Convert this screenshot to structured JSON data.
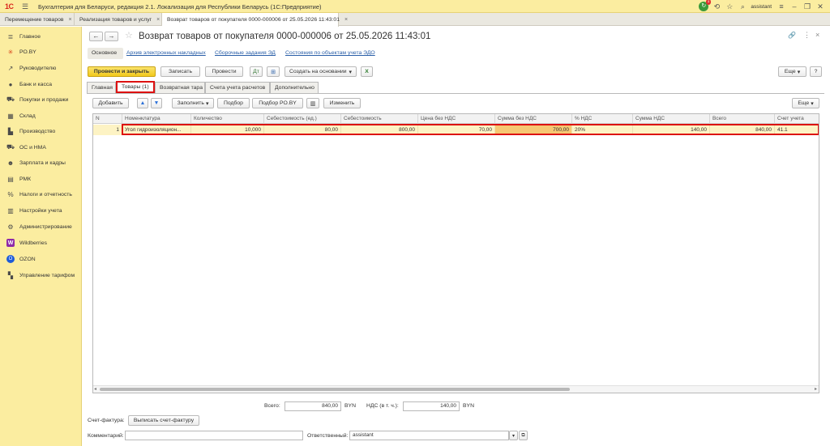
{
  "titlebar": {
    "logo": "1С",
    "menu_icon": "hamburger-icon",
    "title": "Бухгалтерия для Беларуси, редакция 2.1. Локализация для Республики Беларусь   (1С:Предприятие)",
    "notification_count": "1",
    "user": "assistant"
  },
  "doc_tabs": [
    {
      "label": "Перемещение товаров",
      "close": "×"
    },
    {
      "label": "Реализация товаров и услуг",
      "close": "×"
    },
    {
      "label": "Возврат товаров от покупателя 0000-000006 от 25.05.2026 11:43:01",
      "close": "×"
    }
  ],
  "sidebar": {
    "items": [
      {
        "label": "Главное",
        "icon": "menu-lines-icon"
      },
      {
        "label": "PO.BY",
        "icon": "asterisk-icon"
      },
      {
        "label": "Руководителю",
        "icon": "trend-icon"
      },
      {
        "label": "Банк и касса",
        "icon": "coin-icon"
      },
      {
        "label": "Покупки и продажи",
        "icon": "cart-icon"
      },
      {
        "label": "Склад",
        "icon": "warehouse-icon"
      },
      {
        "label": "Производство",
        "icon": "factory-icon"
      },
      {
        "label": "ОС и НМА",
        "icon": "truck-icon"
      },
      {
        "label": "Зарплата и кадры",
        "icon": "people-icon"
      },
      {
        "label": "РМК",
        "icon": "cash-register-icon"
      },
      {
        "label": "Налоги и отчетность",
        "icon": "percent-icon"
      },
      {
        "label": "Настройки учета",
        "icon": "ledger-icon"
      },
      {
        "label": "Администрирование",
        "icon": "gear-icon"
      },
      {
        "label": "Wildberries",
        "icon": "wildberries-icon"
      },
      {
        "label": "OZON",
        "icon": "ozon-icon"
      },
      {
        "label": "Управление тарифом",
        "icon": "grid-icon"
      }
    ]
  },
  "header": {
    "back": "←",
    "forward": "→",
    "star": "☆",
    "title": "Возврат товаров от покупателя 0000-000006 от 25.05.2026 11:43:01",
    "link_icon": "🔗",
    "more": "⋮",
    "close": "×"
  },
  "subnav": {
    "items": [
      "Основное",
      "Архив электронных накладных",
      "Сборочные задания ЭД",
      "Состояния по объектам учета ЭДО"
    ]
  },
  "toolbar": {
    "post_close": "Провести и закрыть",
    "save": "Записать",
    "post": "Провести",
    "create_basis": "Создать на основании",
    "more": "Еще",
    "help": "?"
  },
  "form_tabs": [
    "Главная",
    "Товары (1)",
    "Возвратная тара",
    "Счета учета расчетов",
    "Дополнительно"
  ],
  "table_toolbar": {
    "add": "Добавить",
    "up": "▲",
    "down": "▼",
    "fill": "Заполнить",
    "pick": "Подбор",
    "pick_poby": "Подбор PO.BY",
    "change": "Изменить",
    "more": "Еще"
  },
  "table": {
    "columns": [
      "N",
      "Номенклатура",
      "Количество",
      "Себестоимость (ед.)",
      "Себестоимость",
      "Цена без НДС",
      "Сумма без НДС",
      "% НДС",
      "Сумма НДС",
      "Всего",
      "Счет учета"
    ],
    "rows": [
      [
        "1",
        "Угол гидроизоляцион...",
        "10,000",
        "80,00",
        "800,00",
        "70,00",
        "700,00",
        "20%",
        "140,00",
        "840,00",
        "41.1"
      ]
    ]
  },
  "totals": {
    "total_label": "Всего:",
    "total_value": "840,00",
    "currency1": "BYN",
    "vat_label": "НДС (в т. ч.):",
    "vat_value": "140,00",
    "currency2": "BYN"
  },
  "footer": {
    "invoice_label": "Счет-фактура:",
    "invoice_button": "Выписать счет-фактуру",
    "comment_label": "Комментарий:",
    "comment_value": "",
    "responsible_label": "Ответственный:",
    "responsible_value": "assistant"
  },
  "colors": {
    "panel": "#fbeda0",
    "primary_button": "#f2c91b",
    "row_highlight": "#fdf3c4",
    "cell_highlight": "#f6c773",
    "selection_border": "#dd1111",
    "link": "#2a5fa8"
  }
}
